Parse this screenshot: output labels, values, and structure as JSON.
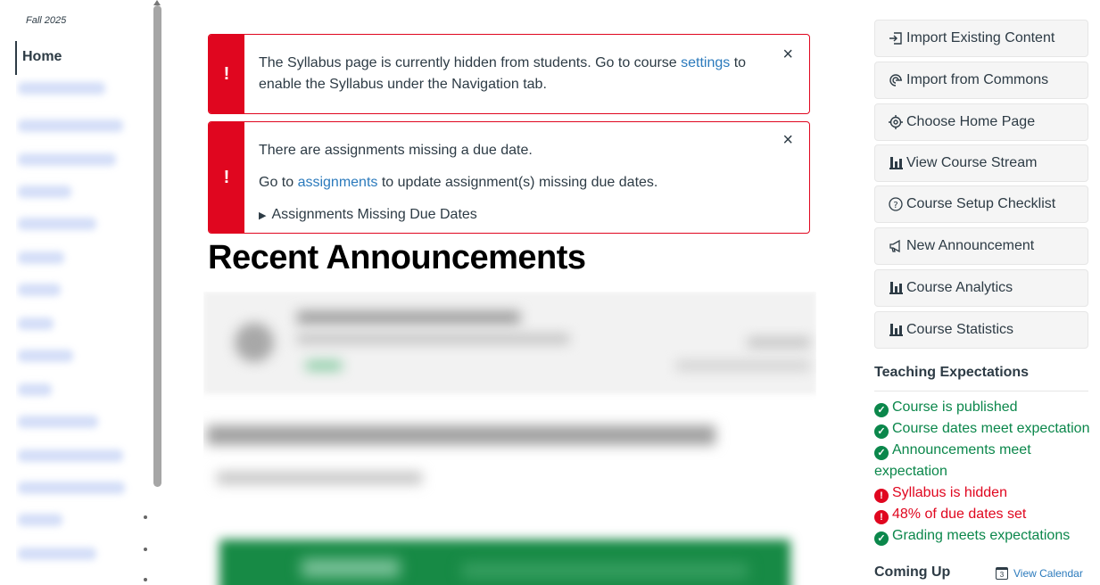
{
  "nav": {
    "term": "Fall 2025",
    "home": "Home"
  },
  "alerts": {
    "syllabus": {
      "icon": "!",
      "text_before": "The Syllabus page is currently hidden from students. Go to course ",
      "link": "settings",
      "text_after": " to",
      "line2": "enable the Syllabus under the Navigation tab.",
      "close": "×"
    },
    "assignments": {
      "icon": "!",
      "line1": "There are assignments missing a due date.",
      "line2_before": "Go to ",
      "link": "assignments",
      "line2_after": " to update assignment(s) missing due dates.",
      "details": "Assignments Missing Due Dates",
      "close": "×"
    }
  },
  "main": {
    "recent_title": "Recent Announcements"
  },
  "sidebar": {
    "buttons": [
      {
        "label": "Import Existing Content",
        "icon": "import-icon"
      },
      {
        "label": "Import from Commons",
        "icon": "commons-icon"
      },
      {
        "label": "Choose Home Page",
        "icon": "target-icon"
      },
      {
        "label": "View Course Stream",
        "icon": "stats-icon"
      },
      {
        "label": "Course Setup Checklist",
        "icon": "question-icon"
      },
      {
        "label": "New Announcement",
        "icon": "announcement-icon"
      },
      {
        "label": "Course Analytics",
        "icon": "stats-icon"
      },
      {
        "label": "Course Statistics",
        "icon": "stats-icon"
      }
    ],
    "teaching_title": "Teaching Expectations",
    "expectations": [
      {
        "text": "Course is published",
        "status": "ok"
      },
      {
        "text": "Course dates meet expectation",
        "status": "ok"
      },
      {
        "text": "Announcements meet expectation",
        "status": "ok"
      },
      {
        "text": "Syllabus is hidden",
        "status": "bad"
      },
      {
        "text": "48% of due dates set",
        "status": "bad"
      },
      {
        "text": "Grading meets expectations",
        "status": "ok"
      }
    ],
    "coming_up": "Coming Up",
    "view_calendar": "View Calendar",
    "calendar_day": "3"
  },
  "colors": {
    "alert_red": "#e0061f",
    "link_blue": "#2b7abc",
    "success_green": "#0b874b"
  }
}
